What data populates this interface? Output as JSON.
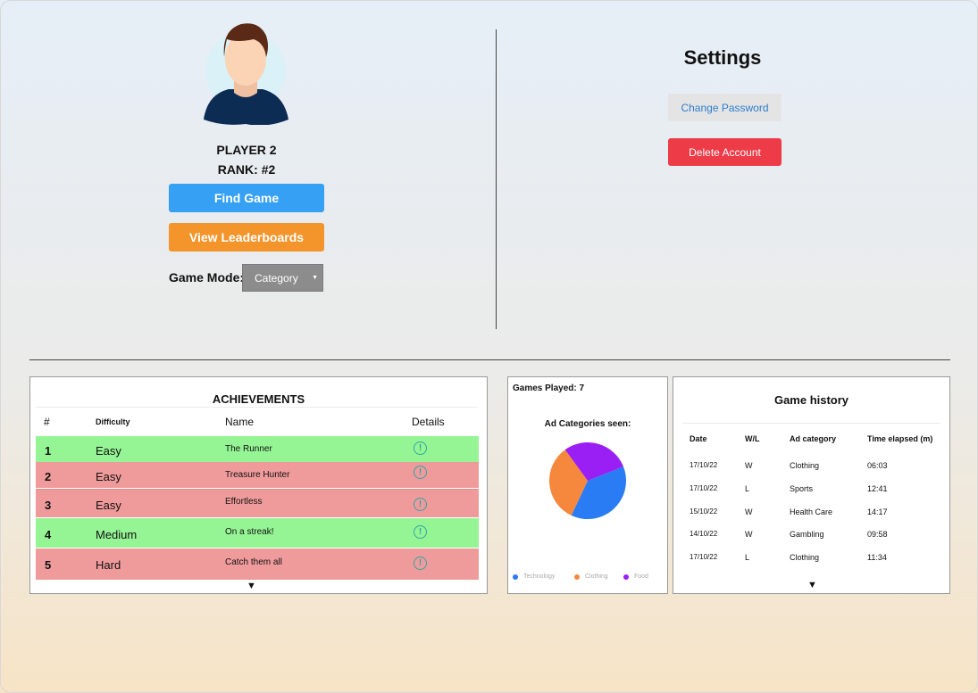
{
  "profile": {
    "name": "PLAYER 2",
    "rank": "RANK: #2",
    "find_game": "Find Game",
    "view_leaderboards": "View Leaderboards",
    "game_mode_label": "Game Mode:",
    "game_mode_value": "Category"
  },
  "settings": {
    "title": "Settings",
    "change_password": "Change Password",
    "delete_account": "Delete Account"
  },
  "achievements": {
    "title": "ACHIEVEMENTS",
    "columns": [
      "#",
      "Difficulty",
      "Name",
      "Details"
    ],
    "rows": [
      {
        "num": "1",
        "difficulty": "Easy",
        "name": "The Runner",
        "status": "complete"
      },
      {
        "num": "2",
        "difficulty": "Easy",
        "name": "Treasure Hunter",
        "status": "incomplete"
      },
      {
        "num": "3",
        "difficulty": "Easy",
        "name": "Effortless",
        "status": "incomplete"
      },
      {
        "num": "4",
        "difficulty": "Medium",
        "name": "On a streak!",
        "status": "complete"
      },
      {
        "num": "5",
        "difficulty": "Hard",
        "name": "Catch them all",
        "status": "incomplete"
      }
    ],
    "info_icon": "!",
    "more_arrow": "▼"
  },
  "stats": {
    "games_played": "Games Played: 7",
    "ad_categories_title": "Ad Categories seen:",
    "legend": [
      {
        "label": "Technology",
        "color": "#2a7cf4"
      },
      {
        "label": "Clothing",
        "color": "#f5883c"
      },
      {
        "label": "Food",
        "color": "#9a1ff5"
      }
    ]
  },
  "chart_data": {
    "type": "pie",
    "title": "Ad Categories seen:",
    "labels": [
      "Technology",
      "Clothing",
      "Food"
    ],
    "values": [
      38,
      33,
      29
    ],
    "colors": [
      "#2a7cf4",
      "#f5883c",
      "#9a1ff5"
    ]
  },
  "history": {
    "title": "Game history",
    "columns": [
      "Date",
      "W/L",
      "Ad category",
      "Time elapsed (m)"
    ],
    "rows": [
      {
        "date": "17/10/22",
        "wl": "W",
        "category": "Clothing",
        "time": "06:03"
      },
      {
        "date": "17/10/22",
        "wl": "L",
        "category": "Sports",
        "time": "12:41"
      },
      {
        "date": "15/10/22",
        "wl": "W",
        "category": "Health Care",
        "time": "14:17"
      },
      {
        "date": "14/10/22",
        "wl": "W",
        "category": "Gambling",
        "time": "09:58"
      },
      {
        "date": "17/10/22",
        "wl": "L",
        "category": "Clothing",
        "time": "11:34"
      }
    ],
    "more_arrow": "▼"
  },
  "colors": {
    "find_game": "#36a0f4",
    "leaderboards": "#f4952c",
    "delete": "#ee3b48",
    "row_complete": "#95f595",
    "row_incomplete": "#f09b9b"
  }
}
